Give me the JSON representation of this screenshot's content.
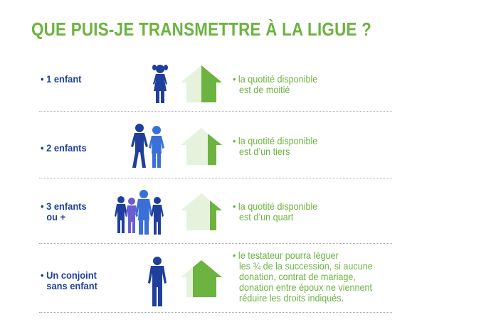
{
  "title": "QUE PUIS-JE TRANSMETTRE À LA LIGUE ?",
  "colors": {
    "green": "#6cb33f",
    "light_green": "#e6f2dc",
    "navy": "#1f3f9b",
    "blue": "#3b6fd8",
    "violet": "#6a5fd0"
  },
  "rows": [
    {
      "label_line1": "• 1 enfant",
      "label_line2": "",
      "icon": "one-child-icon",
      "share_fraction": 0.5,
      "desc_line1": "• la quotité disponible",
      "desc_lines": [
        "est de moitié"
      ]
    },
    {
      "label_line1": "• 2 enfants",
      "label_line2": "",
      "icon": "two-children-icon",
      "share_fraction": 0.333,
      "desc_line1": "• la quotité disponible",
      "desc_lines": [
        "est d’un tiers"
      ]
    },
    {
      "label_line1": "• 3 enfants",
      "label_line2": "ou +",
      "icon": "three-children-icon",
      "share_fraction": 0.25,
      "desc_line1": "• la quotité disponible",
      "desc_lines": [
        "est d’un quart"
      ]
    },
    {
      "label_line1": "• Un conjoint",
      "label_line2": "sans enfant",
      "icon": "spouse-icon",
      "share_fraction": 0.75,
      "desc_line1": "• le testateur pourra léguer",
      "desc_lines": [
        "les ¾ de la succession, si aucune",
        "donation, contrat de mariage,",
        "donation entre époux ne viennent",
        "réduire les droits indiqués."
      ]
    }
  ]
}
